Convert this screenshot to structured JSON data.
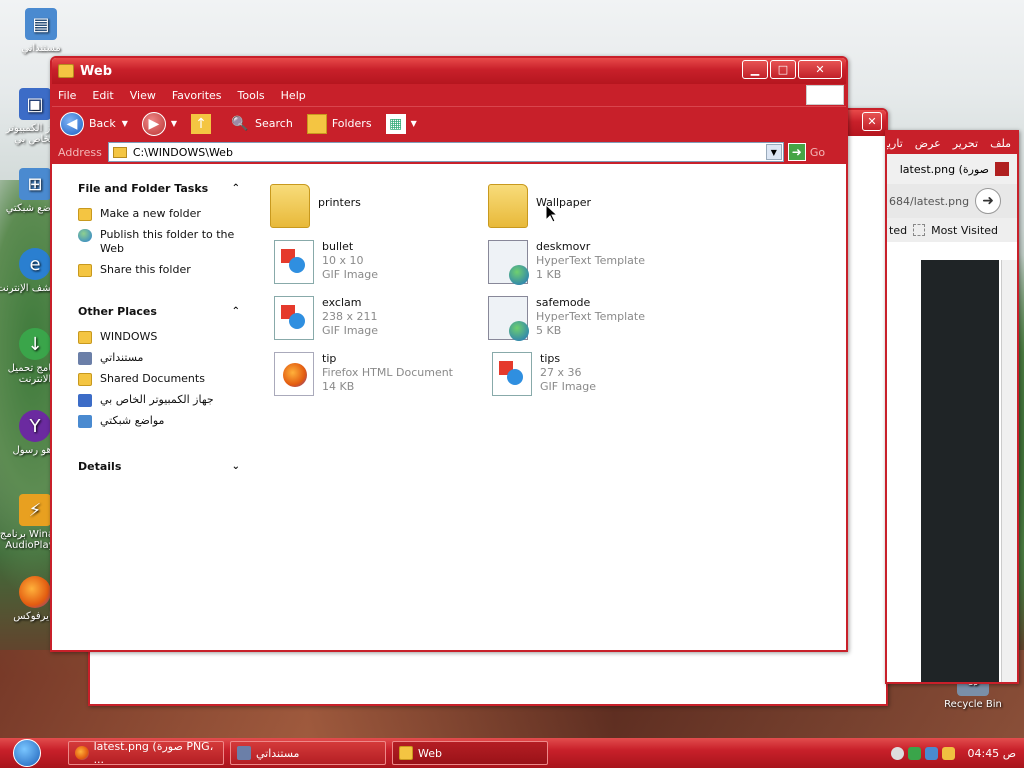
{
  "desktop": {
    "icons": [
      {
        "label": "مستنداتي"
      },
      {
        "label": "جهاز الكمبيوتر الخاص بي"
      },
      {
        "label": "مواضع شبكتي"
      },
      {
        "label": "مستكشف الإنترنت"
      },
      {
        "label": "برنامج تحميل الانترنت"
      },
      {
        "label": "ياهو رسول"
      },
      {
        "label": "برنامج Winamp AudioPlayer"
      },
      {
        "label": "فايرفوكس"
      }
    ],
    "recycle_bin": "Recycle Bin"
  },
  "back_firefox": {
    "menu": [
      "ملف",
      "تحرير",
      "عرض",
      "تاريخ"
    ],
    "tab_title": "latest.png (صورة",
    "url": "684/latest.png",
    "bookmarks": [
      "ted",
      "Most Visited"
    ],
    "go_label": "Go"
  },
  "explorer": {
    "title": "Web",
    "menu": [
      "File",
      "Edit",
      "View",
      "Favorites",
      "Tools",
      "Help"
    ],
    "toolbar": {
      "back": "Back",
      "search": "Search",
      "folders": "Folders"
    },
    "address": {
      "label": "Address",
      "value": "C:\\WINDOWS\\Web",
      "go": "Go"
    },
    "tasks": {
      "file_folder": {
        "header": "File and Folder Tasks",
        "items": [
          "Make a new folder",
          "Publish this folder to the Web",
          "Share this folder"
        ]
      },
      "other_places": {
        "header": "Other Places",
        "items": [
          "WINDOWS",
          "مستنداتي",
          "Shared Documents",
          "جهاز الكمبيوتر الخاص بي",
          "مواضع شبكتي"
        ]
      },
      "details": {
        "header": "Details"
      }
    },
    "files": [
      {
        "name": "printers",
        "type": "folder"
      },
      {
        "name": "Wallpaper",
        "type": "folder"
      },
      {
        "name": "bullet",
        "dims": "10 x 10",
        "kind": "GIF Image",
        "type": "gif"
      },
      {
        "name": "deskmovr",
        "kind": "HyperText Template",
        "size": "1 KB",
        "type": "htt"
      },
      {
        "name": "exclam",
        "dims": "238 x 211",
        "kind": "GIF Image",
        "type": "gif"
      },
      {
        "name": "safemode",
        "kind": "HyperText Template",
        "size": "5 KB",
        "type": "htt"
      },
      {
        "name": "tip",
        "kind": "Firefox HTML Document",
        "size": "14 KB",
        "type": "ff"
      },
      {
        "name": "tips",
        "dims": "27 x 36",
        "kind": "GIF Image",
        "type": "gif"
      }
    ]
  },
  "taskbar": {
    "tasks": [
      "latest.png (صورة PNG، ...",
      "مستنداتي",
      "Web"
    ],
    "clock": "04:45 ص"
  }
}
